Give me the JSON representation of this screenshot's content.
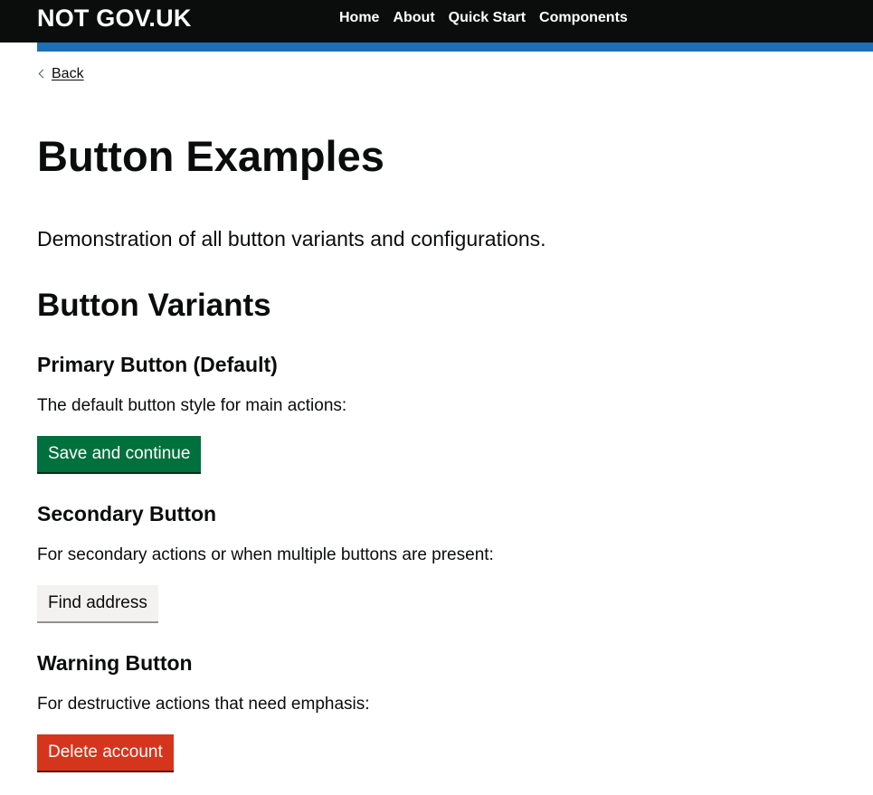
{
  "header": {
    "logo": "NOT GOV.UK",
    "nav": [
      "Home",
      "About",
      "Quick Start",
      "Components"
    ]
  },
  "back": {
    "label": "Back"
  },
  "page": {
    "title": "Button Examples",
    "lead": "Demonstration of all button variants and configurations."
  },
  "variants": {
    "heading": "Button Variants",
    "primary": {
      "heading": "Primary Button (Default)",
      "description": "The default button style for main actions:",
      "button_label": "Save and continue"
    },
    "secondary": {
      "heading": "Secondary Button",
      "description": "For secondary actions or when multiple buttons are present:",
      "button_label": "Find address"
    },
    "warning": {
      "heading": "Warning Button",
      "description": "For destructive actions that need emphasis:",
      "button_label": "Delete account"
    }
  },
  "colors": {
    "header_bg": "#0b0c0c",
    "accent_bar": "#1d70b8",
    "primary": "#00703c",
    "secondary": "#f3f2f1",
    "warning": "#d4351c"
  }
}
